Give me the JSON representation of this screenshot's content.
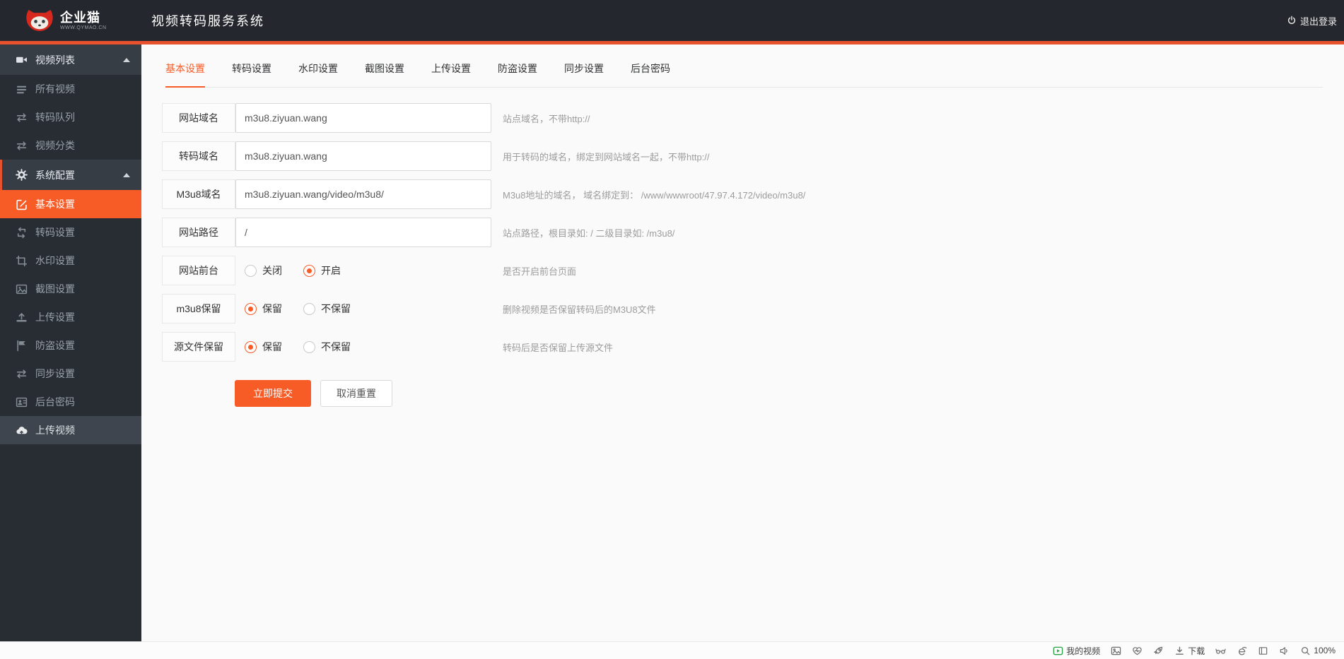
{
  "header": {
    "logo_title": "企业猫",
    "logo_subtitle": "WWW.QYMAO.CN",
    "title": "视频转码服务系统",
    "logout": "退出登录"
  },
  "colors": {
    "accent": "#f75c27",
    "header_line": "#e8512e",
    "header_bg": "#24272d",
    "sidebar_bg": "#282d33",
    "sidebar_section_bg": "#373d45",
    "sidebar_upload_bg": "#3f454e",
    "content_bg": "#fafafa",
    "hint_text": "#9c9c9c",
    "statusbar_green": "#2ba245"
  },
  "sidebar": {
    "items": [
      {
        "name": "video-list",
        "label": "视频列表",
        "icon": "video-camera-icon",
        "type": "section",
        "chevron": "up"
      },
      {
        "name": "all-videos",
        "label": "所有视频",
        "icon": "list-icon",
        "type": "item"
      },
      {
        "name": "transcode-queue",
        "label": "转码队列",
        "icon": "swap-icon",
        "type": "item"
      },
      {
        "name": "video-category",
        "label": "视频分类",
        "icon": "swap-icon",
        "type": "item"
      },
      {
        "name": "system-config",
        "label": "系统配置",
        "icon": "gear-icon",
        "type": "section",
        "chevron": "up",
        "section_active": true
      },
      {
        "name": "basic-settings",
        "label": "基本设置",
        "icon": "edit-icon",
        "type": "item",
        "active": true
      },
      {
        "name": "transcode-settings",
        "label": "转码设置",
        "icon": "loop-icon",
        "type": "item"
      },
      {
        "name": "watermark-settings",
        "label": "水印设置",
        "icon": "crop-icon",
        "type": "item"
      },
      {
        "name": "screenshot-settings",
        "label": "截图设置",
        "icon": "image-icon",
        "type": "item"
      },
      {
        "name": "upload-settings",
        "label": "上传设置",
        "icon": "upload-icon",
        "type": "item"
      },
      {
        "name": "antitheft-settings",
        "label": "防盗设置",
        "icon": "flag-icon",
        "type": "item"
      },
      {
        "name": "sync-settings",
        "label": "同步设置",
        "icon": "swap-icon",
        "type": "item"
      },
      {
        "name": "admin-password",
        "label": "后台密码",
        "icon": "idcard-icon",
        "type": "item"
      },
      {
        "name": "upload-video",
        "label": "上传视频",
        "icon": "cloud-upload-icon",
        "type": "upload"
      }
    ]
  },
  "tabs": {
    "items": [
      {
        "name": "basic-settings",
        "label": "基本设置",
        "active": true
      },
      {
        "name": "transcode-settings",
        "label": "转码设置"
      },
      {
        "name": "watermark-settings",
        "label": "水印设置"
      },
      {
        "name": "screenshot-settings",
        "label": "截图设置"
      },
      {
        "name": "upload-settings",
        "label": "上传设置"
      },
      {
        "name": "antitheft-settings",
        "label": "防盗设置"
      },
      {
        "name": "sync-settings",
        "label": "同步设置"
      },
      {
        "name": "admin-password",
        "label": "后台密码"
      }
    ]
  },
  "form": {
    "rows": [
      {
        "type": "input",
        "name": "website-domain",
        "label": "网站域名",
        "value": "m3u8.ziyuan.wang",
        "hint": "站点域名，不带http://"
      },
      {
        "type": "input",
        "name": "transcode-domain",
        "label": "转码域名",
        "value": "m3u8.ziyuan.wang",
        "hint": "用于转码的域名，绑定到网站域名一起，不带http://"
      },
      {
        "type": "input",
        "name": "m3u8-domain",
        "label": "M3u8域名",
        "value": "m3u8.ziyuan.wang/video/m3u8/",
        "hint": "M3u8地址的域名， 域名绑定到： /www/wwwroot/47.97.4.172/video/m3u8/"
      },
      {
        "type": "input",
        "name": "site-path",
        "label": "网站路径",
        "value": "/",
        "hint": "站点路径，根目录如: / 二级目录如: /m3u8/"
      },
      {
        "type": "radio",
        "name": "site-front",
        "label": "网站前台",
        "options": [
          {
            "label": "关闭",
            "selected": false
          },
          {
            "label": "开启",
            "selected": true
          }
        ],
        "hint": "是否开启前台页面"
      },
      {
        "type": "radio",
        "name": "m3u8-keep",
        "label": "m3u8保留",
        "options": [
          {
            "label": "保留",
            "selected": true
          },
          {
            "label": "不保留",
            "selected": false
          }
        ],
        "hint": "删除视频是否保留转码后的M3U8文件"
      },
      {
        "type": "radio",
        "name": "source-keep",
        "label": "源文件保留",
        "options": [
          {
            "label": "保留",
            "selected": true
          },
          {
            "label": "不保留",
            "selected": false
          }
        ],
        "hint": "转码后是否保留上传源文件"
      }
    ],
    "submit_label": "立即提交",
    "reset_label": "取消重置"
  },
  "statusbar": {
    "items": [
      {
        "name": "my-videos",
        "icon": "play-box-icon",
        "label": "我的视频"
      },
      {
        "name": "picture",
        "icon": "picture-icon"
      },
      {
        "name": "heart",
        "icon": "heart-pulse-icon"
      },
      {
        "name": "rocket",
        "icon": "rocket-icon"
      },
      {
        "name": "download",
        "icon": "download-icon",
        "label": "下载"
      },
      {
        "name": "glasses",
        "icon": "glasses-icon"
      },
      {
        "name": "ie",
        "icon": "ie-icon"
      },
      {
        "name": "window",
        "icon": "window-icon"
      },
      {
        "name": "speaker",
        "icon": "speaker-icon"
      },
      {
        "name": "zoom",
        "icon": "magnifier-icon",
        "label": "100%"
      }
    ]
  }
}
